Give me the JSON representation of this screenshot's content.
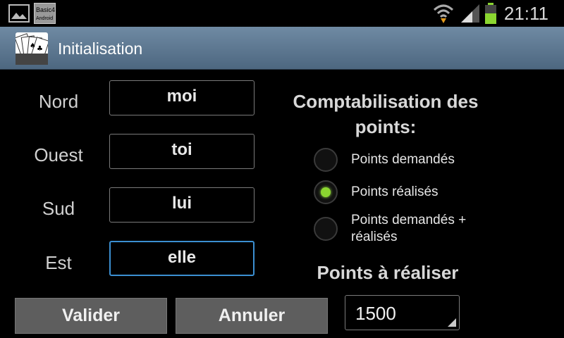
{
  "statusbar": {
    "time": "21:11",
    "icons": [
      "gallery-icon",
      "app-notification-icon",
      "wifi-icon",
      "signal-icon",
      "battery-charging-icon"
    ],
    "app_notification_text": "Basic4 Android"
  },
  "titlebar": {
    "title": "Initialisation",
    "icon": "playing-cards-icon"
  },
  "players": [
    {
      "direction": "Nord",
      "name": "moi",
      "focused": false
    },
    {
      "direction": "Ouest",
      "name": "toi",
      "focused": false
    },
    {
      "direction": "Sud",
      "name": "lui",
      "focused": false
    },
    {
      "direction": "Est",
      "name": "elle",
      "focused": true
    }
  ],
  "scoring": {
    "title": "Comptabilisation des points:",
    "options": [
      {
        "label": "Points demandés",
        "checked": false
      },
      {
        "label": "Points réalisés",
        "checked": true
      },
      {
        "label": "Points demandés + réalisés",
        "checked": false
      }
    ]
  },
  "target": {
    "title": "Points à réaliser",
    "value": "1500"
  },
  "buttons": {
    "validate": "Valider",
    "cancel": "Annuler"
  },
  "colors": {
    "accent_focus": "#3b8fd1",
    "radio_checked": "#8bd630",
    "titlebar": "#5f7a93"
  }
}
